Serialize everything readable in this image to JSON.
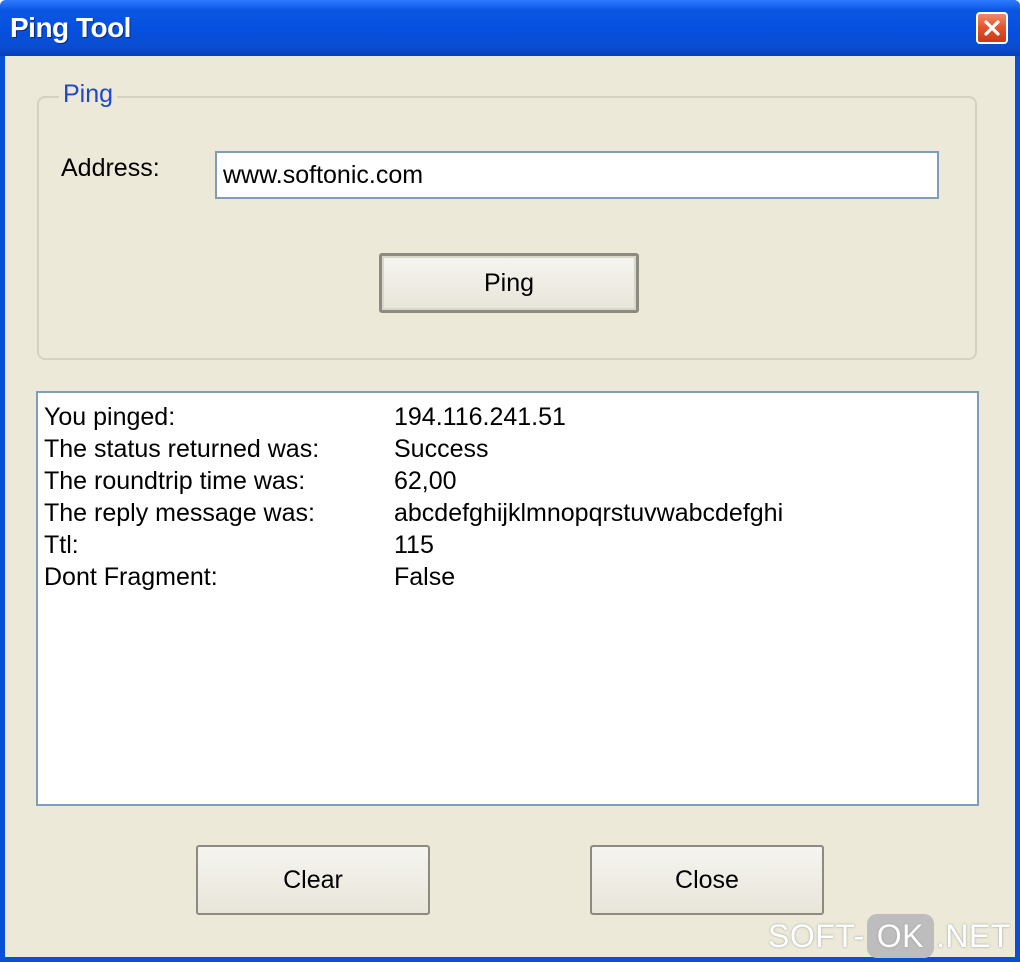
{
  "window": {
    "title": "Ping Tool",
    "close_icon": "close-icon"
  },
  "ping_group": {
    "legend": "Ping",
    "address_label": "Address:",
    "address_value": "www.softonic.com",
    "ping_button": "Ping"
  },
  "results": [
    {
      "key": "You pinged:",
      "value": "194.116.241.51"
    },
    {
      "key": "The status returned was:",
      "value": "Success"
    },
    {
      "key": "The roundtrip time was:",
      "value": "62,00"
    },
    {
      "key": "The reply message was:",
      "value": "abcdefghijklmnopqrstuvwabcdefghi"
    },
    {
      "key": "Ttl:",
      "value": "115"
    },
    {
      "key": "Dont Fragment:",
      "value": "False"
    }
  ],
  "buttons": {
    "clear": "Clear",
    "close": "Close"
  },
  "watermark": {
    "prefix": "SOFT-",
    "badge": "OK",
    "suffix": ".NET"
  },
  "colors": {
    "titlebar": "#0550de",
    "window_bg": "#ece9d8",
    "legend_text": "#1f48c8",
    "close_button": "#e2522b"
  }
}
